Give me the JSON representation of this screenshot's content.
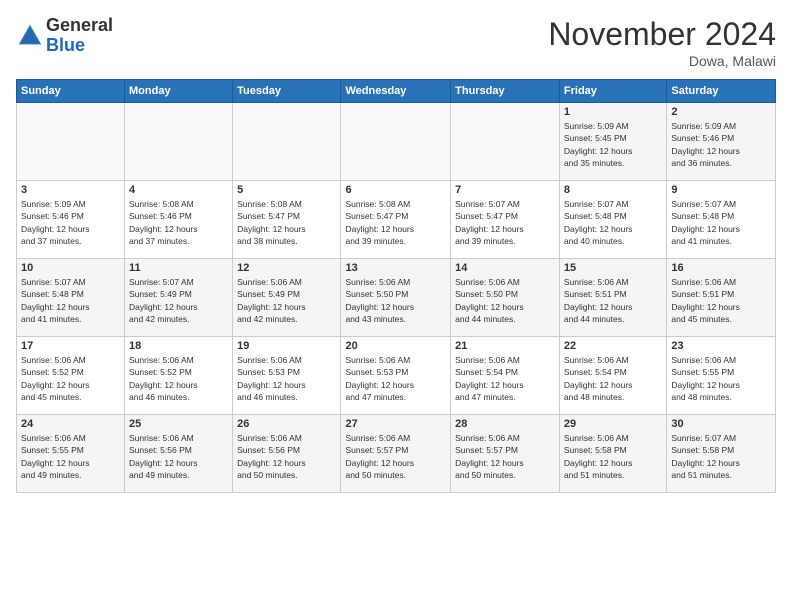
{
  "logo": {
    "general": "General",
    "blue": "Blue"
  },
  "title": "November 2024",
  "location": "Dowa, Malawi",
  "weekdays": [
    "Sunday",
    "Monday",
    "Tuesday",
    "Wednesday",
    "Thursday",
    "Friday",
    "Saturday"
  ],
  "weeks": [
    [
      {
        "day": "",
        "info": ""
      },
      {
        "day": "",
        "info": ""
      },
      {
        "day": "",
        "info": ""
      },
      {
        "day": "",
        "info": ""
      },
      {
        "day": "",
        "info": ""
      },
      {
        "day": "1",
        "info": "Sunrise: 5:09 AM\nSunset: 5:45 PM\nDaylight: 12 hours\nand 35 minutes."
      },
      {
        "day": "2",
        "info": "Sunrise: 5:09 AM\nSunset: 5:46 PM\nDaylight: 12 hours\nand 36 minutes."
      }
    ],
    [
      {
        "day": "3",
        "info": "Sunrise: 5:09 AM\nSunset: 5:46 PM\nDaylight: 12 hours\nand 37 minutes."
      },
      {
        "day": "4",
        "info": "Sunrise: 5:08 AM\nSunset: 5:46 PM\nDaylight: 12 hours\nand 37 minutes."
      },
      {
        "day": "5",
        "info": "Sunrise: 5:08 AM\nSunset: 5:47 PM\nDaylight: 12 hours\nand 38 minutes."
      },
      {
        "day": "6",
        "info": "Sunrise: 5:08 AM\nSunset: 5:47 PM\nDaylight: 12 hours\nand 39 minutes."
      },
      {
        "day": "7",
        "info": "Sunrise: 5:07 AM\nSunset: 5:47 PM\nDaylight: 12 hours\nand 39 minutes."
      },
      {
        "day": "8",
        "info": "Sunrise: 5:07 AM\nSunset: 5:48 PM\nDaylight: 12 hours\nand 40 minutes."
      },
      {
        "day": "9",
        "info": "Sunrise: 5:07 AM\nSunset: 5:48 PM\nDaylight: 12 hours\nand 41 minutes."
      }
    ],
    [
      {
        "day": "10",
        "info": "Sunrise: 5:07 AM\nSunset: 5:48 PM\nDaylight: 12 hours\nand 41 minutes."
      },
      {
        "day": "11",
        "info": "Sunrise: 5:07 AM\nSunset: 5:49 PM\nDaylight: 12 hours\nand 42 minutes."
      },
      {
        "day": "12",
        "info": "Sunrise: 5:06 AM\nSunset: 5:49 PM\nDaylight: 12 hours\nand 42 minutes."
      },
      {
        "day": "13",
        "info": "Sunrise: 5:06 AM\nSunset: 5:50 PM\nDaylight: 12 hours\nand 43 minutes."
      },
      {
        "day": "14",
        "info": "Sunrise: 5:06 AM\nSunset: 5:50 PM\nDaylight: 12 hours\nand 44 minutes."
      },
      {
        "day": "15",
        "info": "Sunrise: 5:06 AM\nSunset: 5:51 PM\nDaylight: 12 hours\nand 44 minutes."
      },
      {
        "day": "16",
        "info": "Sunrise: 5:06 AM\nSunset: 5:51 PM\nDaylight: 12 hours\nand 45 minutes."
      }
    ],
    [
      {
        "day": "17",
        "info": "Sunrise: 5:06 AM\nSunset: 5:52 PM\nDaylight: 12 hours\nand 45 minutes."
      },
      {
        "day": "18",
        "info": "Sunrise: 5:06 AM\nSunset: 5:52 PM\nDaylight: 12 hours\nand 46 minutes."
      },
      {
        "day": "19",
        "info": "Sunrise: 5:06 AM\nSunset: 5:53 PM\nDaylight: 12 hours\nand 46 minutes."
      },
      {
        "day": "20",
        "info": "Sunrise: 5:06 AM\nSunset: 5:53 PM\nDaylight: 12 hours\nand 47 minutes."
      },
      {
        "day": "21",
        "info": "Sunrise: 5:06 AM\nSunset: 5:54 PM\nDaylight: 12 hours\nand 47 minutes."
      },
      {
        "day": "22",
        "info": "Sunrise: 5:06 AM\nSunset: 5:54 PM\nDaylight: 12 hours\nand 48 minutes."
      },
      {
        "day": "23",
        "info": "Sunrise: 5:06 AM\nSunset: 5:55 PM\nDaylight: 12 hours\nand 48 minutes."
      }
    ],
    [
      {
        "day": "24",
        "info": "Sunrise: 5:06 AM\nSunset: 5:55 PM\nDaylight: 12 hours\nand 49 minutes."
      },
      {
        "day": "25",
        "info": "Sunrise: 5:06 AM\nSunset: 5:56 PM\nDaylight: 12 hours\nand 49 minutes."
      },
      {
        "day": "26",
        "info": "Sunrise: 5:06 AM\nSunset: 5:56 PM\nDaylight: 12 hours\nand 50 minutes."
      },
      {
        "day": "27",
        "info": "Sunrise: 5:06 AM\nSunset: 5:57 PM\nDaylight: 12 hours\nand 50 minutes."
      },
      {
        "day": "28",
        "info": "Sunrise: 5:06 AM\nSunset: 5:57 PM\nDaylight: 12 hours\nand 50 minutes."
      },
      {
        "day": "29",
        "info": "Sunrise: 5:06 AM\nSunset: 5:58 PM\nDaylight: 12 hours\nand 51 minutes."
      },
      {
        "day": "30",
        "info": "Sunrise: 5:07 AM\nSunset: 5:58 PM\nDaylight: 12 hours\nand 51 minutes."
      }
    ]
  ]
}
